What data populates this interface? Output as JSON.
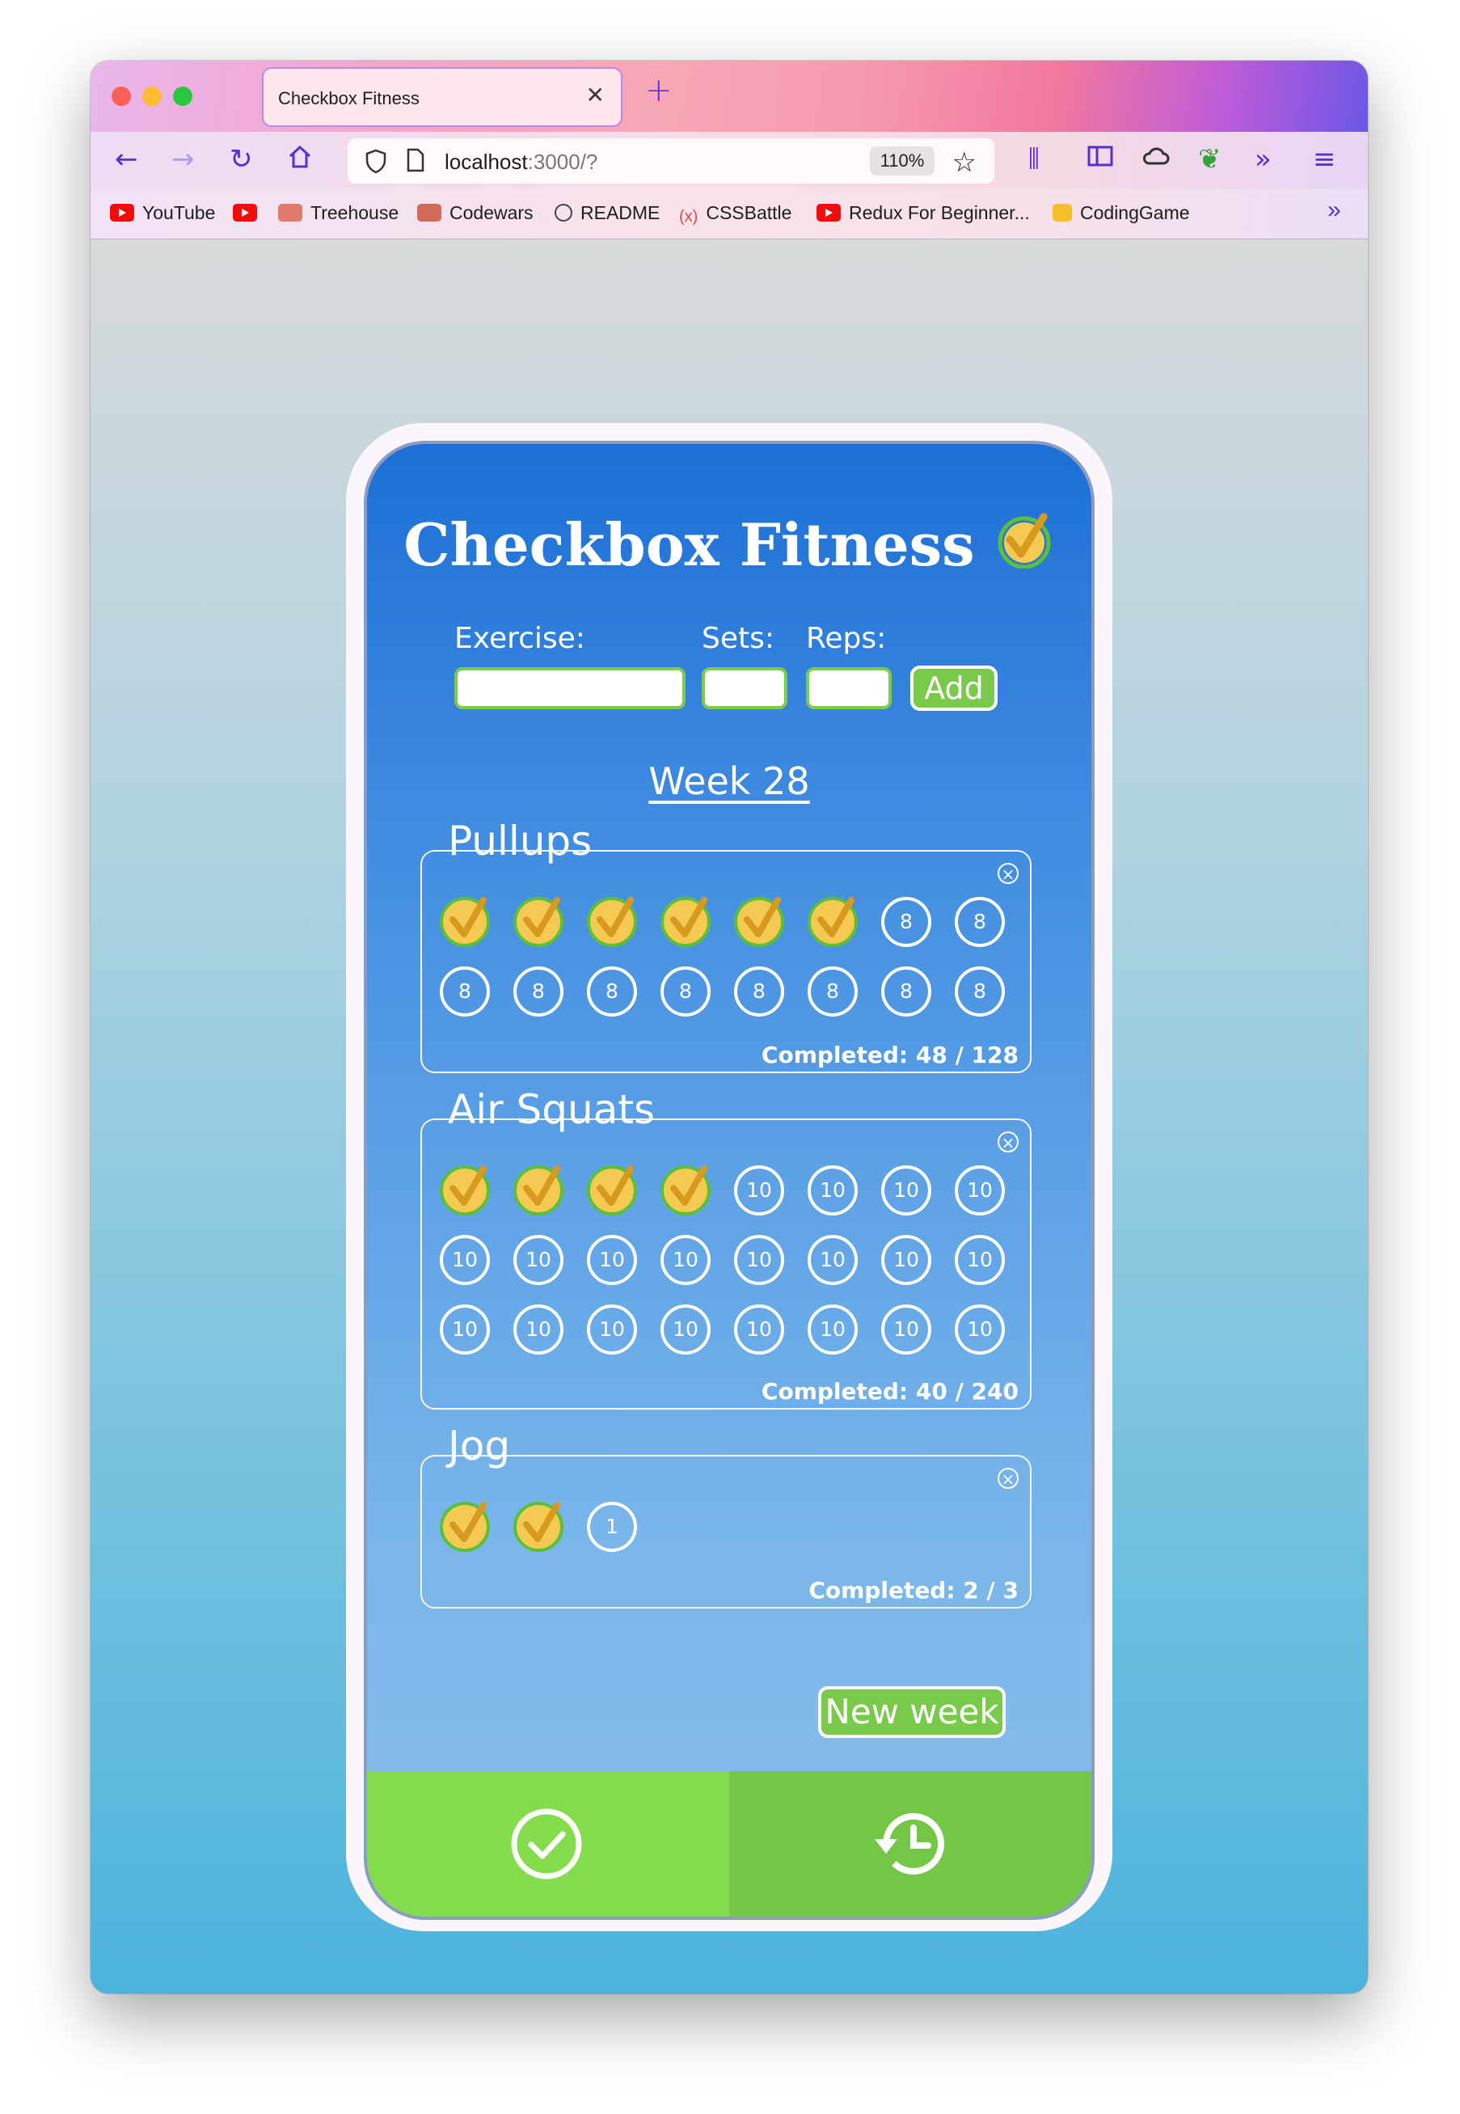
{
  "browser": {
    "tab_title": "Checkbox Fitness",
    "url_host": "localhost",
    "url_rest": ":3000/?",
    "zoom": "110%",
    "bookmarks": [
      "YouTube",
      "",
      "Treehouse",
      "Codewars",
      "README",
      "CSSBattle",
      "Redux For Beginner...",
      "CodingGame"
    ]
  },
  "app": {
    "title": "Checkbox Fitness",
    "form": {
      "exercise_label": "Exercise:",
      "sets_label": "Sets:",
      "reps_label": "Reps:",
      "exercise_value": "",
      "sets_value": "",
      "reps_value": "",
      "add_label": "Add"
    },
    "week": "Week 28",
    "exercises": [
      {
        "name": "Pullups",
        "done": 6,
        "total_sets": 16,
        "reps": "8",
        "completed": "Completed: 48 / 128"
      },
      {
        "name": "Air Squats",
        "done": 4,
        "total_sets": 24,
        "reps": "10",
        "completed": "Completed: 40 / 240"
      },
      {
        "name": "Jog",
        "done": 2,
        "total_sets": 3,
        "reps": "1",
        "completed": "Completed: 2 / 3"
      }
    ],
    "new_week_label": "New week",
    "nav": {
      "left_icon": "check-circle-icon",
      "right_icon": "history-icon"
    }
  },
  "colors": {
    "accent_green": "#79c94a",
    "check_gold": "#f5ca52",
    "check_ring": "#5bbf3a"
  }
}
